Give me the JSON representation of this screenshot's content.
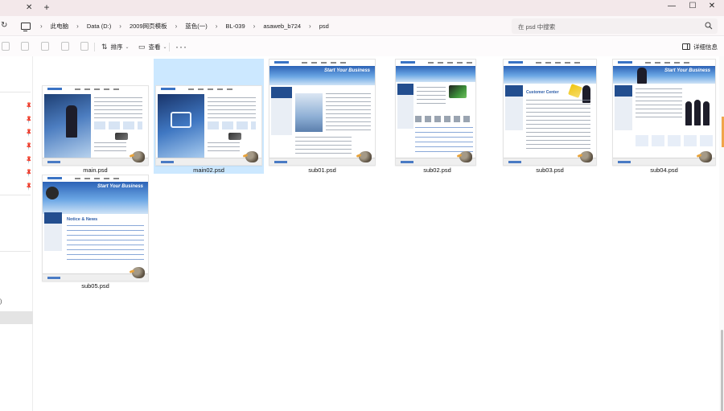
{
  "titlebar": {
    "close_glyph": "✕",
    "new_tab_glyph": "+",
    "minimize_glyph": "—",
    "maximize_glyph": "☐",
    "window_close_glyph": "✕"
  },
  "address": {
    "refresh_glyph": "↻",
    "separator": "›",
    "crumbs": [
      "此电脑",
      "Data (D:)",
      "2009网页模板",
      "蓝色(一)",
      "BL-039",
      "asaweb_b724",
      "psd"
    ],
    "search_placeholder": "在 psd 中搜索"
  },
  "commandbar": {
    "sort_label": "排序",
    "view_label": "查看",
    "more_label": "···",
    "details_label": "详细信息",
    "caret": "⌄"
  },
  "navpane": {
    "fragment_text": ")"
  },
  "files": [
    {
      "name": "main.psd",
      "selected": false
    },
    {
      "name": "main02.psd",
      "selected": true
    },
    {
      "name": "sub01.psd",
      "selected": false
    },
    {
      "name": "sub02.psd",
      "selected": false
    },
    {
      "name": "sub03.psd",
      "selected": false
    },
    {
      "name": "sub04.psd",
      "selected": false
    },
    {
      "name": "sub05.psd",
      "selected": false
    }
  ],
  "thumb_text": {
    "banner_tag": "Start Your Business",
    "customer_center": "Customer Center",
    "notice_news": "Notice & News"
  },
  "colors": {
    "selection": "#cce8ff",
    "titlebar": "#f3e8ea",
    "accent": "#3a73c4"
  }
}
